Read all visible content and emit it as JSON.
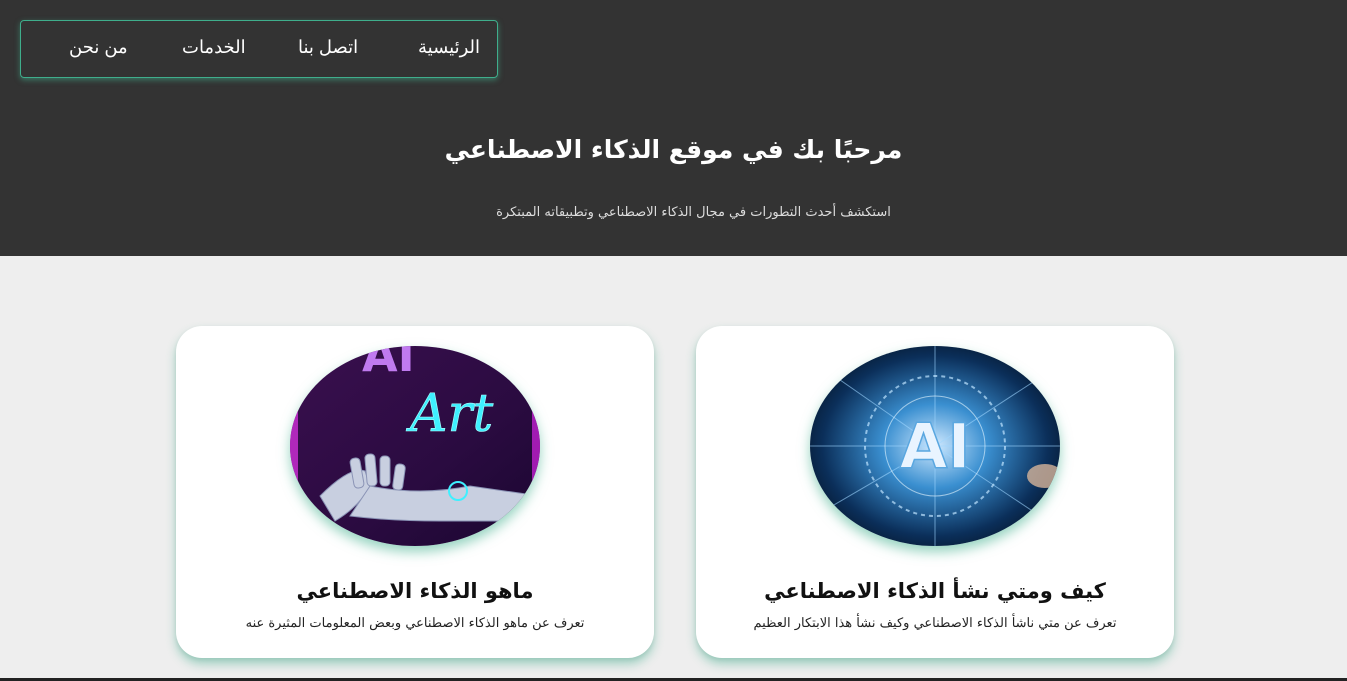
{
  "nav": {
    "items": [
      {
        "label": "الرئيسية"
      },
      {
        "label": "اتصل بنا"
      },
      {
        "label": "الخدمات"
      },
      {
        "label": "من نحن"
      }
    ]
  },
  "hero": {
    "title": "مرحبًا بك في موقع الذكاء الاصطناعي",
    "subtitle": "استكشف أحدث التطورات في مجال الذكاء الاصطناعي وتطبيقاته المبتكرة"
  },
  "cards": [
    {
      "title": "كيف ومتي نشأ الذكاء الاصطناعي",
      "description": "تعرف عن متي ناشأ الذكاء الاصطناعي وكيف نشأ هذا الابتكار العظيم",
      "image_text": "AI"
    },
    {
      "title": "ماهو الذكاء الاصطناعي",
      "description": "تعرف عن ماهو الذكاء الاصطناعي وبعض المعلومات المثيرة عنه",
      "image_text_top": "AI",
      "image_text_neon": "Art"
    }
  ],
  "colors": {
    "header_bg": "#333333",
    "page_bg": "#eeeeee",
    "accent": "#3fae8c"
  }
}
